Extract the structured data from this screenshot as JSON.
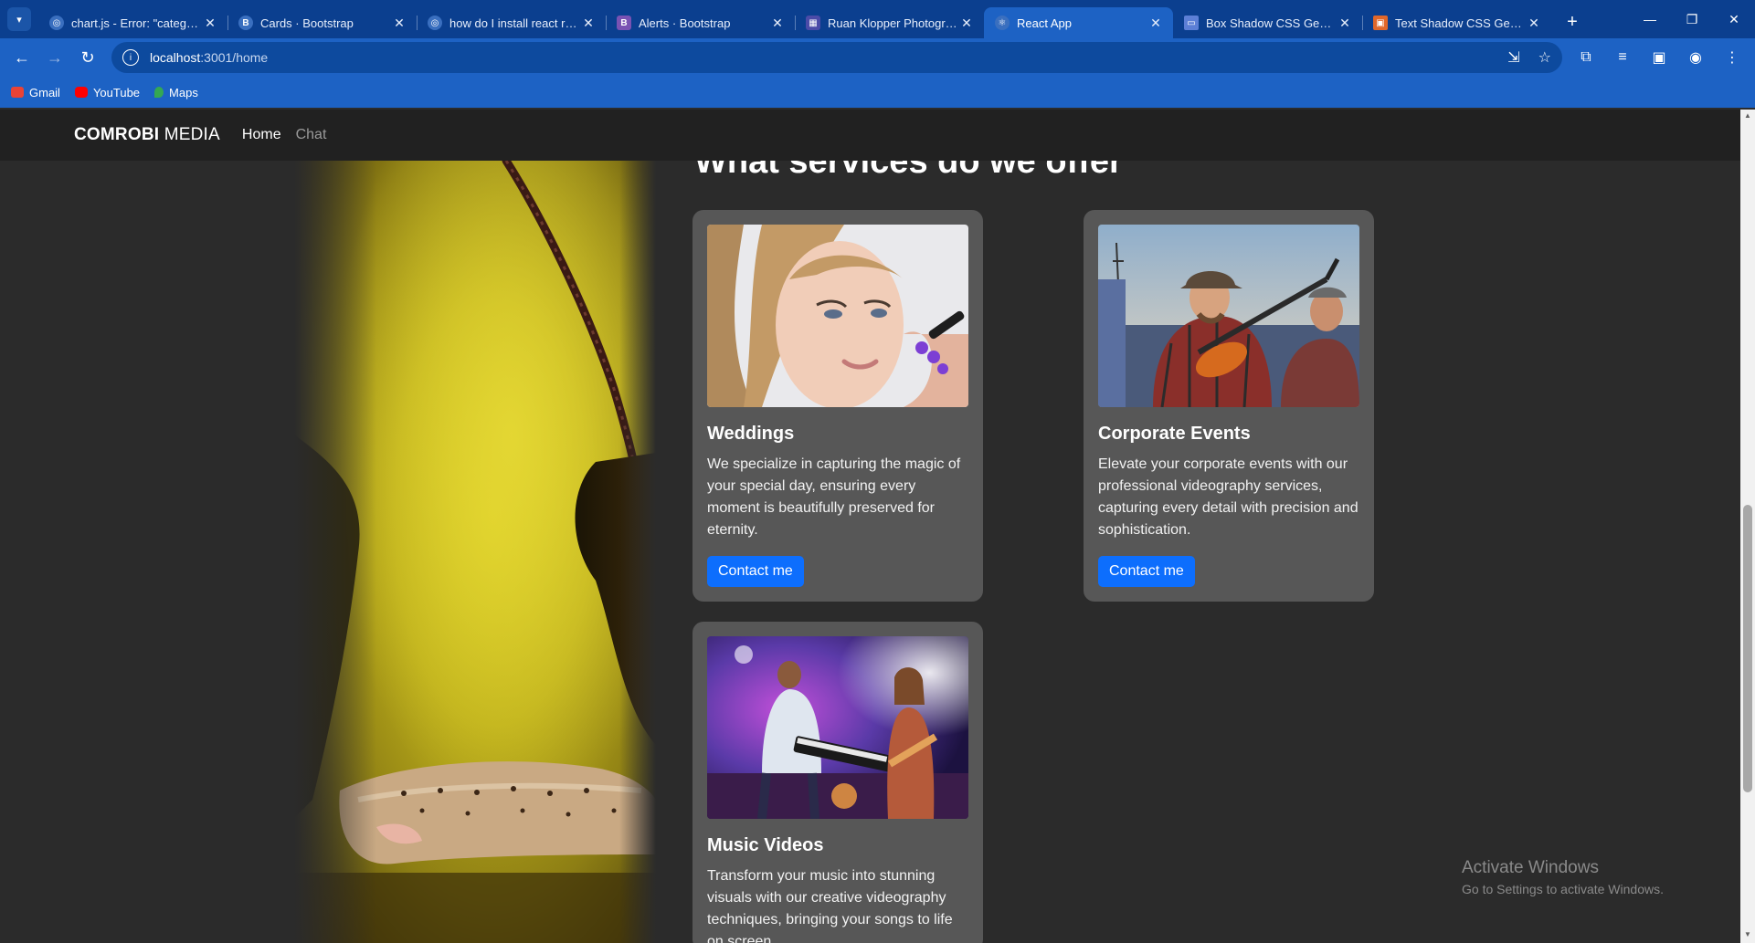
{
  "browser": {
    "tabs": [
      {
        "title": "chart.js - Error: \"category\"",
        "favicon_color": "#3a6fbf",
        "favicon_glyph": "◎"
      },
      {
        "title": "Cards · Bootstrap",
        "favicon_color": "#3a6fbf",
        "favicon_glyph": "B"
      },
      {
        "title": "how do I install react rout",
        "favicon_color": "#3a6fbf",
        "favicon_glyph": "◎"
      },
      {
        "title": "Alerts · Bootstrap",
        "favicon_color": "#7952b3",
        "favicon_glyph": "B"
      },
      {
        "title": "Ruan Klopper Photograph",
        "favicon_color": "#4b4ba8",
        "favicon_glyph": "▦"
      },
      {
        "title": "React App",
        "favicon_color": "#3a6fbf",
        "favicon_glyph": "⚛"
      },
      {
        "title": "Box Shadow CSS Generat",
        "favicon_color": "#5c7fd6",
        "favicon_glyph": "▭"
      },
      {
        "title": "Text Shadow CSS Generat",
        "favicon_color": "#e0672a",
        "favicon_glyph": "▣"
      }
    ],
    "url_host": "localhost",
    "url_path": ":3001/home",
    "bookmarks": [
      {
        "label": "Gmail",
        "color": "#ea4335"
      },
      {
        "label": "YouTube",
        "color": "#ff0000"
      },
      {
        "label": "Maps",
        "color": "#34a853"
      }
    ]
  },
  "navbar": {
    "brand_bold": "COMROBI",
    "brand_rest": "MEDIA",
    "links": [
      {
        "label": "Home"
      },
      {
        "label": "Chat"
      }
    ]
  },
  "section": {
    "title": "What services do we offer"
  },
  "cards": [
    {
      "title": "Weddings",
      "text": "We specialize in capturing the magic of your special day, ensuring every moment is beautifully preserved for eternity.",
      "button": "Contact me"
    },
    {
      "title": "Corporate Events",
      "text": "Elevate your corporate events with our professional videography services, capturing every detail with precision and sophistication.",
      "button": "Contact me"
    },
    {
      "title": "Music Videos",
      "text": "Transform your music into stunning visuals with our creative videography techniques, bringing your songs to life on screen.",
      "button": "Contact me"
    }
  ],
  "watermark": {
    "title": "Activate Windows",
    "subtitle": "Go to Settings to activate Windows."
  },
  "colors": {
    "page_bg": "#2b2b2b",
    "navbar_bg": "#212121",
    "card_bg": "#575757",
    "button": "#0d6efd",
    "browser_accent": "#1d62c4"
  }
}
